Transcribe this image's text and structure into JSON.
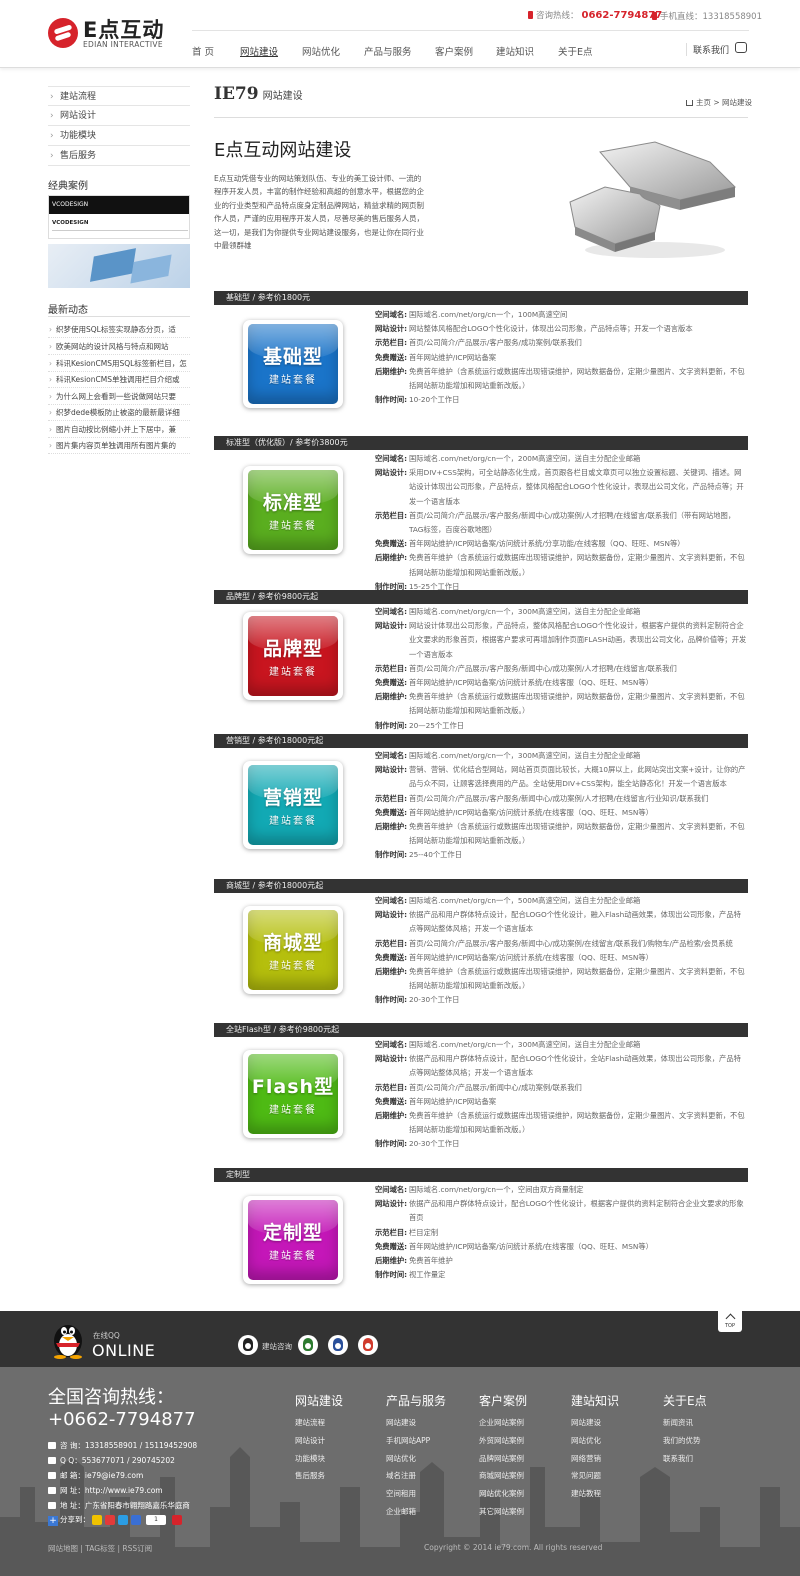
{
  "header": {
    "logo_text": "E点互动",
    "logo_sub": "EDIAN INTERACTIVE",
    "hotline_label": "咨询热线：",
    "hotline_number": "0662-7794877",
    "mobile_label": "手机直线：",
    "mobile_number": "13318558901",
    "nav": [
      "首 页",
      "网站建设",
      "网站优化",
      "产品与服务",
      "客户案例",
      "建站知识",
      "关于E点"
    ],
    "contact_label": "联系我们"
  },
  "sidebar": {
    "links": [
      "建站流程",
      "网站设计",
      "功能模块",
      "售后服务"
    ],
    "cases_title": "经典案例",
    "case_img_label": "VCODESIGN",
    "news_title": "最新动态",
    "news": [
      "织梦使用SQL标签实现静态分页，适",
      "欧美网站的设计风格与特点和网站",
      "科讯KesionCMS用SQL标签新栏目，怎",
      "科讯KesionCMS单独调用栏目介绍或",
      "为什么网上会看到一些说做网站只要",
      "织梦dede模板防止被盗的最新最详细",
      "图片自动按比例缩小并上下居中，兼",
      "图片集内容页单独调用所有图片集的"
    ]
  },
  "main": {
    "section_brand": "IE79",
    "section_name": "网站建设",
    "breadcrumb": "主页 > 网站建设",
    "intro_title": "E点互动网站建设",
    "intro_text": "E点互动凭借专业的网站策划队伍、专业的美工设计师、一流的程序开发人员，丰富的制作经验和高超的创意水平，根据您的企业的行业类型和产品特点度身定制品牌网站，精益求精的网页制作人员，严谨的应用程序开发人员，尽善尽美的售后服务人员，这一切，是我们为你提供专业网站建设服务，也是让你在同行业中最领群雄"
  },
  "packages": [
    {
      "header": "基础型 / 参考价1800元",
      "badge_title": "基础型",
      "badge_sub": "建站套餐",
      "color": "#1a74c9",
      "specs": [
        {
          "label": "空间域名:",
          "value": "国际域名.com/net/org/cn一个，100M高速空间"
        },
        {
          "label": "网站设计:",
          "value": "网站整体风格配合LOGO个性化设计，体现出公司形象，产品特点等；开发一个语言版本"
        },
        {
          "label": "示范栏目:",
          "value": "首页/公司简介/产品展示/客户服务/成功案例/联系我们"
        },
        {
          "label": "免费赠送:",
          "value": "首年网站维护/ICP网站备案"
        },
        {
          "label": "后期维护:",
          "value": "免费首年维护（含系统运行或数据库出现错误维护，网站数据备份，定期少量图片、文字资料更新，不包括网站新功能增加和网站重新改版。）"
        },
        {
          "label": "制作时间:",
          "value": "10-20个工作日"
        }
      ]
    },
    {
      "header": "标准型（优化版）/ 参考价3800元",
      "badge_title": "标准型",
      "badge_sub": "建站套餐",
      "color": "#5aae1f",
      "specs": [
        {
          "label": "空间域名:",
          "value": "国际域名.com/net/org/cn一个，200M高速空间，送自主分配企业邮箱"
        },
        {
          "label": "网站设计:",
          "value": "采用DIV+CSS架构，可全站静态化生成，首页跟各栏目或文章页可以独立设置标题、关键词、描述。网站设计体现出公司形象，产品特点，整体风格配合LOGO个性化设计，表现出公司文化，产品特点等；开发一个语言版本"
        },
        {
          "label": "示范栏目:",
          "value": "首页/公司简介/产品展示/客户服务/新闻中心/成功案例/人才招聘/在线留言/联系我们（带有网站地图，TAG标签，百度谷歌地图）"
        },
        {
          "label": "免费赠送:",
          "value": "首年网站维护/ICP网站备案/访问统计系统/分享功能/在线客服（QQ、旺旺、MSN等）"
        },
        {
          "label": "后期维护:",
          "value": "免费首年维护（含系统运行或数据库出现错误维护，网站数据备份，定期少量图片、文字资料更新，不包括网站新功能增加和网站重新改版。）"
        },
        {
          "label": "制作时间:",
          "value": "15-25个工作日"
        }
      ]
    },
    {
      "header": "品牌型 / 参考价9800元起",
      "badge_title": "品牌型",
      "badge_sub": "建站套餐",
      "color": "#c8151f",
      "specs": [
        {
          "label": "空间域名:",
          "value": "国际域名.com/net/org/cn一个，300M高速空间，送自主分配企业邮箱"
        },
        {
          "label": "网站设计:",
          "value": "网站设计体现出公司形象，产品特点，整体风格配合LOGO个性化设计，根据客户提供的资料定制符合企业文要求的形象首页，根据客户要求可再增加制作页面FLASH动画，表现出公司文化，品牌价值等；开发一个语言版本"
        },
        {
          "label": "示范栏目:",
          "value": "首页/公司简介/产品展示/客户服务/新闻中心/成功案例/人才招聘/在线留言/联系我们"
        },
        {
          "label": "免费赠送:",
          "value": "首年网站维护/ICP网站备案/访问统计系统/在线客服（QQ、旺旺、MSN等）"
        },
        {
          "label": "后期维护:",
          "value": "免费首年维护（含系统运行或数据库出现错误维护，网站数据备份，定期少量图片、文字资料更新，不包括网站新功能增加和网站重新改版。）"
        },
        {
          "label": "制作时间:",
          "value": "20—25个工作日"
        }
      ]
    },
    {
      "header": "营销型 / 参考价18000元起",
      "badge_title": "营销型",
      "badge_sub": "建站套餐",
      "color": "#12a9b4",
      "specs": [
        {
          "label": "空间域名:",
          "value": "国际域名.com/net/org/cn一个，300M高速空间，送自主分配企业邮箱"
        },
        {
          "label": "网站设计:",
          "value": "营销、营销、优化结合型网站，网站首页页面比较长，大概10屏以上，此网站突出文案+设计，让你的产品与众不同，让顾客选择费用的产品。全站使用DIV+CSS架构，能全站静态化！开发一个语言版本"
        },
        {
          "label": "示范栏目:",
          "value": "首页/公司简介/产品展示/客户服务/新闻中心/成功案例/人才招聘/在线留言/行业知识/联系我们"
        },
        {
          "label": "免费赠送:",
          "value": "首年网站维护/ICP网站备案/访问统计系统/在线客服（QQ、旺旺、MSN等）"
        },
        {
          "label": "后期维护:",
          "value": "免费首年维护（含系统运行或数据库出现错误维护，网站数据备份，定期少量图片、文字资料更新，不包括网站新功能增加和网站重新改版。）"
        },
        {
          "label": "制作时间:",
          "value": "25--40个工作日"
        }
      ]
    },
    {
      "header": "商城型 / 参考价18000元起",
      "badge_title": "商城型",
      "badge_sub": "建站套餐",
      "color": "#b5bf0d",
      "specs": [
        {
          "label": "空间域名:",
          "value": "国际域名.com/net/org/cn一个，500M高速空间，送自主分配企业邮箱"
        },
        {
          "label": "网站设计:",
          "value": "依据产品和用户群体特点设计，配合LOGO个性化设计，融入Flash动画效果，体现出公司形象，产品特点等网站整体风格；开发一个语言版本"
        },
        {
          "label": "示范栏目:",
          "value": "首页/公司简介/产品展示/客户服务/新闻中心/成功案例/在线留言/联系我们/购物车/产品检索/会员系统"
        },
        {
          "label": "免费赠送:",
          "value": "首年网站维护/ICP网站备案/访问统计系统/在线客服（QQ、旺旺、MSN等）"
        },
        {
          "label": "后期维护:",
          "value": "免费首年维护（含系统运行或数据库出现错误维护，网站数据备份，定期少量图片、文字资料更新，不包括网站新功能增加和网站重新改版。）"
        },
        {
          "label": "制作时间:",
          "value": "20-30个工作日"
        }
      ]
    },
    {
      "header": "全站Flash型 / 参考价9800元起",
      "badge_title": "Flash型",
      "badge_sub": "建站套餐",
      "color": "#4eba14",
      "specs": [
        {
          "label": "空间域名:",
          "value": "国际域名.com/net/org/cn一个，300M高速空间，送自主分配企业邮箱"
        },
        {
          "label": "网站设计:",
          "value": "依据产品和用户群体特点设计，配合LOGO个性化设计，全站Flash动画效果，体现出公司形象，产品特点等网站整体风格；开发一个语言版本"
        },
        {
          "label": "示范栏目:",
          "value": "首页/公司简介/产品展示/新闻中心/成功案例/联系我们"
        },
        {
          "label": "免费赠送:",
          "value": "首年网站维护/ICP网站备案"
        },
        {
          "label": "后期维护:",
          "value": "免费首年维护（含系统运行或数据库出现错误维护，网站数据备份，定期少量图片、文字资料更新，不包括网站新功能增加和网站重新改版。）"
        },
        {
          "label": "制作时间:",
          "value": "20-30个工作日"
        }
      ]
    },
    {
      "header": "定制型",
      "badge_title": "定制型",
      "badge_sub": "建站套餐",
      "color": "#c417b8",
      "specs": [
        {
          "label": "空间域名:",
          "value": "国际域名.com/net/org/cn一个，空间由双方商量制定"
        },
        {
          "label": "网站设计:",
          "value": "依据产品和用户群体特点设计，配合LOGO个性化设计，根据客户提供的资料定制符合企业文要求的形象首页"
        },
        {
          "label": "示范栏目:",
          "value": "栏目定制"
        },
        {
          "label": "免费赠送:",
          "value": "首年网站维护/ICP网站备案/访问统计系统/在线客服（QQ、旺旺、MSN等）"
        },
        {
          "label": "后期维护:",
          "value": "免费首年维护"
        },
        {
          "label": "制作时间:",
          "value": "视工作量定"
        }
      ]
    }
  ],
  "footer": {
    "online_small": "在线QQ",
    "online_big": "ONLINE",
    "qq_label": "建站咨询",
    "top_label": "TOP",
    "hotline_title": "全国咨询热线：",
    "hotline_number": "+0662-7794877",
    "contacts": [
      "咨 询：13318558901 / 15119452908",
      "Q Q：553677071 / 290745202",
      "邮 箱：ie79@ie79.com",
      "网 址：http://www.ie79.com",
      "地 址：广东省阳春市翱翔路嘉乐华庭商"
    ],
    "share_label": "分享到：",
    "share_count": "1",
    "columns": [
      {
        "title": "网站建设",
        "links": [
          "建站流程",
          "网站设计",
          "功能模块",
          "售后服务"
        ]
      },
      {
        "title": "产品与服务",
        "links": [
          "网站建设",
          "手机网站APP",
          "网站优化",
          "域名注册",
          "空间租用",
          "企业邮箱"
        ]
      },
      {
        "title": "客户案例",
        "links": [
          "企业网站案例",
          "外贸网站案例",
          "品牌网站案例",
          "商城网站案例",
          "网站优化案例",
          "其它网站案例"
        ]
      },
      {
        "title": "建站知识",
        "links": [
          "网站建设",
          "网站优化",
          "网络营销",
          "常见问题",
          "建站教程"
        ]
      },
      {
        "title": "关于E点",
        "links": [
          "新闻资讯",
          "我们的优势",
          "联系我们"
        ]
      }
    ],
    "bottom_links": "网站地图 | TAG标签 | RSS订阅",
    "copyright": "Copyright © 2014 ie79.com. All rights reserved"
  },
  "colors": {
    "accent": "#d6232b",
    "dark_bar": "#333333",
    "footer_gray": "#6d6d6d"
  }
}
